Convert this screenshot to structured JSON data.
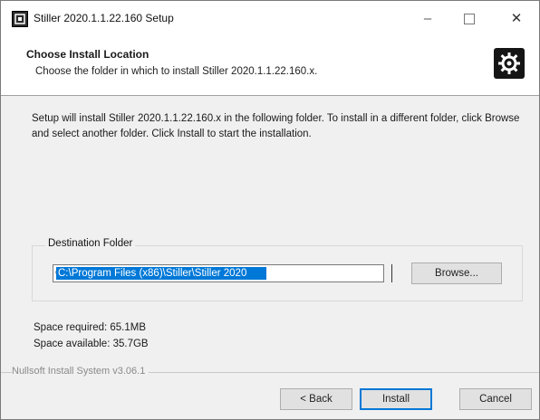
{
  "window": {
    "title": "Stiller 2020.1.1.22.160 Setup",
    "min_glyph": "–",
    "close_glyph": "✕"
  },
  "icons": {
    "app": "installer-app-icon",
    "logo": "gear-logo-icon"
  },
  "header": {
    "title": "Choose Install Location",
    "subtitle": "Choose the folder in which to install Stiller 2020.1.1.22.160.x."
  },
  "description": "Setup will install Stiller 2020.1.1.22.160.x in the following folder. To install in a different folder, click Browse and select another folder. Click Install to start the installation.",
  "destination": {
    "label": "Destination Folder",
    "value": "C:\\Program Files (x86)\\Stiller\\Stiller 2020",
    "browse_label": "Browse..."
  },
  "space": {
    "required": "Space required: 65.1MB",
    "available": "Space available: 35.7GB"
  },
  "footer": {
    "branding": "Nullsoft Install System v3.06.1"
  },
  "buttons": {
    "back": "< Back",
    "install": "Install",
    "cancel": "Cancel"
  },
  "colors": {
    "selection": "#0078d7",
    "window_bg": "#f0f0f0",
    "header_bg": "#ffffff"
  }
}
